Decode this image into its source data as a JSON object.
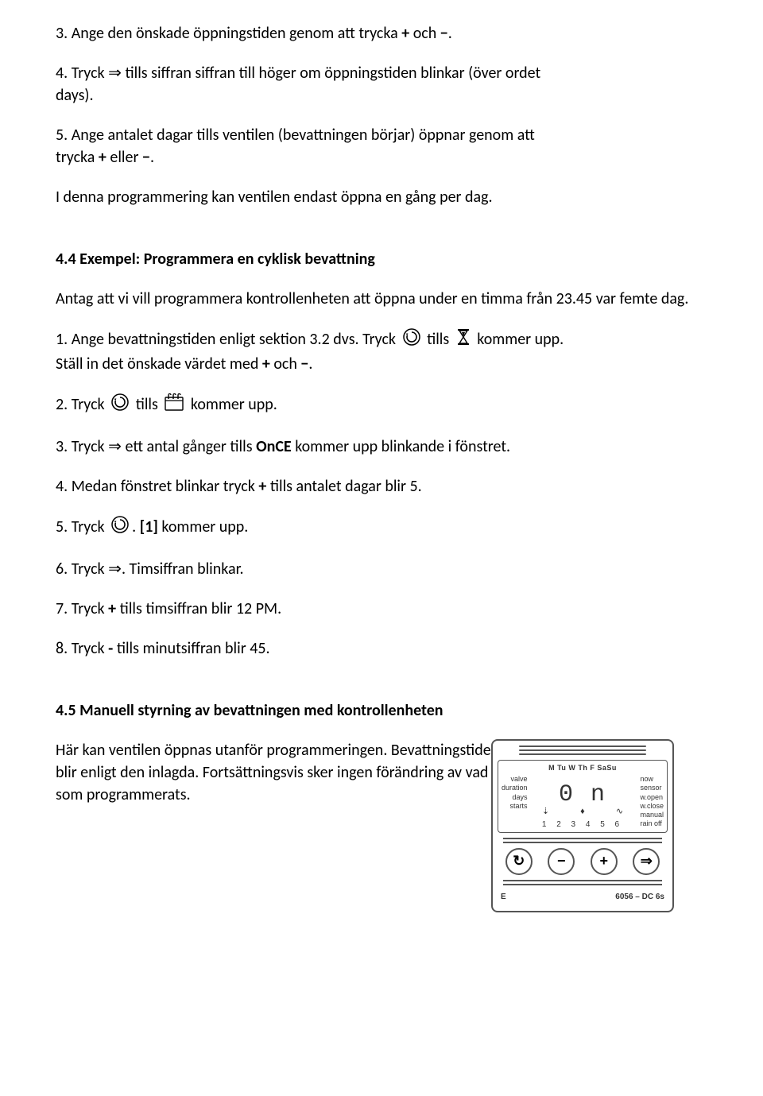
{
  "p3": {
    "pre": "3. Ange den önskade öppningstiden genom att trycka",
    "plus": "+",
    "mid": "och",
    "minus": "−",
    "post": "."
  },
  "p4": {
    "pre": "4. Tryck",
    "arrow": "⇒",
    "post": "tills siffran siffran till höger om öppningstiden blinkar (över ordet",
    "line2pre": "days)."
  },
  "p5": {
    "pre": "5. Ange antalet dagar tills ventilen (bevattningen börjar) öppnar genom att",
    "line2a": "trycka",
    "plus": "+",
    "mid": "eller",
    "minus": "−",
    "post": "."
  },
  "p5b": "I denna programmering kan ventilen endast öppna en gång per dag.",
  "h44": "4.4 Exempel: Programmera en cyklisk bevattning",
  "ex_intro": "Antag att vi vill programmera kontrollenheten att öppna under en timma från 23.45 var femte dag.",
  "ex1": {
    "a": "1. Ange bevattningstiden enligt sektion 3.2 dvs. Tryck",
    "b": "tills",
    "c": "kommer upp.",
    "d": "Ställ in det önskade värdet med",
    "plus": "+",
    "mid": "och",
    "minus": "−",
    "post": "."
  },
  "ex2": {
    "a": "2. Tryck",
    "b": "tills",
    "c": "kommer upp."
  },
  "ex3": {
    "a": "3. Tryck",
    "arrow": "⇒",
    "b": "ett antal gånger tills",
    "once": "OnCE",
    "c": "kommer upp blinkande i fönstret."
  },
  "ex4": {
    "a": "4. Medan fönstret blinkar tryck",
    "plus": "+",
    "b": "tills antalet dagar blir 5."
  },
  "ex5": {
    "a": "5. Tryck",
    "b": ".",
    "bold": "[1]",
    "c": "kommer upp."
  },
  "ex6": {
    "a": "6. Tryck",
    "arrow": "⇒",
    "b": ". Timsiffran blinkar."
  },
  "ex7": {
    "a": "7. Tryck",
    "plus": "+",
    "b": "tills timsiffran blir 12 PM."
  },
  "ex8": {
    "a": "8. Tryck",
    "minus": "-",
    "b": "tills minutsiffran blir 45."
  },
  "h45": "4.5 Manuell styrning av bevattningen med kontrollenheten",
  "man1": "Här kan ventilen öppnas utanför programmeringen. Bevattningstiden blir enligt den inlagda. Fortsättningsvis sker ingen förändring av vad som programmerats.",
  "device": {
    "days": "M Tu W Th F SaSu",
    "left": [
      "valve",
      "duration",
      "days",
      "starts"
    ],
    "right": [
      "now",
      "sensor",
      "w.open",
      "w.close",
      "manual",
      "rain off"
    ],
    "digits": "0 n",
    "midrow": "⇣ ♦ ∿",
    "bottom": "1 2 3 4 5 6",
    "footerL": "E",
    "footerR": "6056 – DC 6s",
    "btns": {
      "cycle": "↻",
      "minus": "−",
      "plus": "+",
      "arrow": "⇒"
    }
  }
}
